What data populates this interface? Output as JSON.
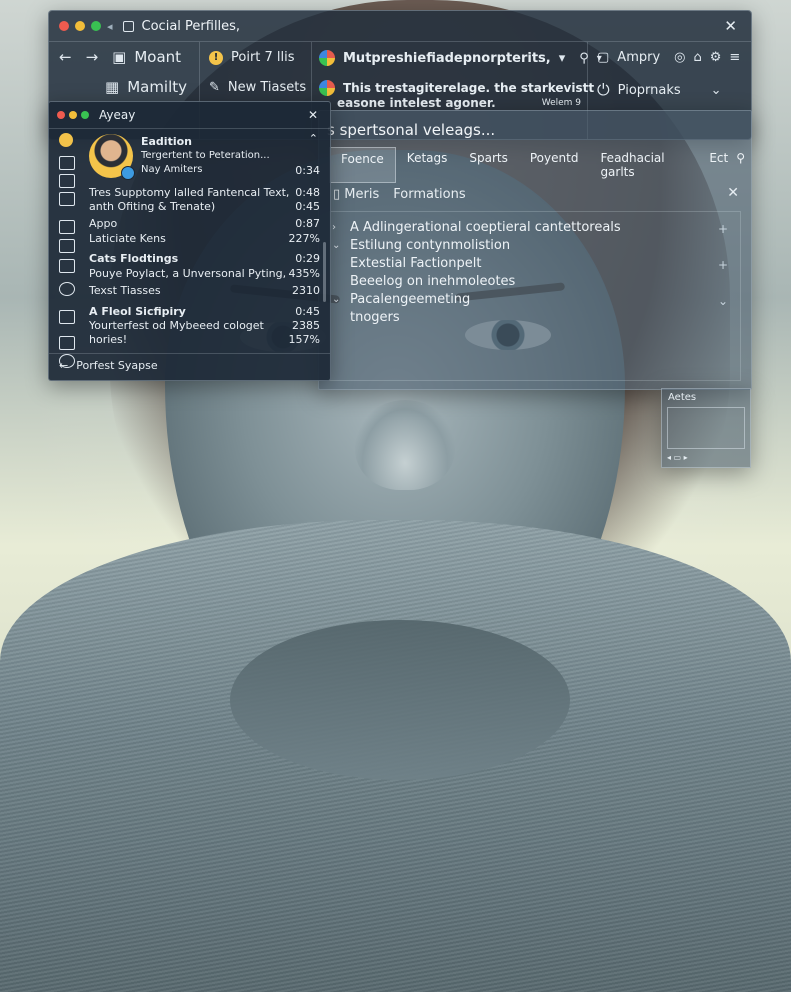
{
  "main_window": {
    "title": "Cocial Perfilles,",
    "nav": {
      "back": "←",
      "forward": "→",
      "item1": "Moant",
      "item2": "Mamilty"
    },
    "col2": {
      "item1": "Poirt 7  llis",
      "item2": "New Tiasets"
    },
    "col3": {
      "line1": "Mutpreshiefiadepnorpterits,",
      "line2a": "This trestagiterelage. the starkevistt",
      "line2b": "easone intelest agoner.",
      "line2c": "Welem 9"
    },
    "col4": {
      "item1": "Ampry",
      "item2": "Pioprnaks"
    }
  },
  "panel2": {
    "heading": "s spertsonal veleags...",
    "tabs": [
      "Foence",
      "Ketags",
      "Sparts",
      "Poyentd",
      "Feadhacial garlts",
      "Ect"
    ],
    "sub_tab1": "Meris",
    "sub_tab2": "Formations",
    "items": [
      "A Adlingerational coeptieral cantettoreals",
      "Estilung contynmolistion",
      "Extestial Factionpelt",
      "Beeelog on inehmoleotes",
      "Pacalengeemeting",
      "tnogers"
    ]
  },
  "left_window": {
    "title": "Ayeay",
    "profile_name": "Eadition",
    "profile_sub1": "Tergertent to Peteration...",
    "profile_sub2": "Nay Amiters",
    "rows": [
      {
        "label": "Tres Supptomy lalled Fantencal Text,",
        "value": "0:48"
      },
      {
        "label": "anth Ofiting & Trenate)",
        "value": "0:45"
      },
      {
        "label": "Appo",
        "value": "0:87"
      },
      {
        "label": "Laticiate Kens",
        "value": "227%"
      },
      {
        "label": "Cats Flodtings",
        "value": "0:29"
      },
      {
        "label": "Pouye Poylact, a Unversonal Pyting,",
        "value": "435%"
      },
      {
        "label": "Texst Tiasses",
        "value": "2310"
      },
      {
        "label": "A Fleol Sicfipiry",
        "value": "0:45"
      },
      {
        "label": "Yourterfest od Mybeeed cologet",
        "value": "2385"
      },
      {
        "label": "hories!",
        "value": "157%"
      }
    ],
    "footer": "Porfest Syapse"
  },
  "mini_panel": {
    "label": "Aetes"
  }
}
